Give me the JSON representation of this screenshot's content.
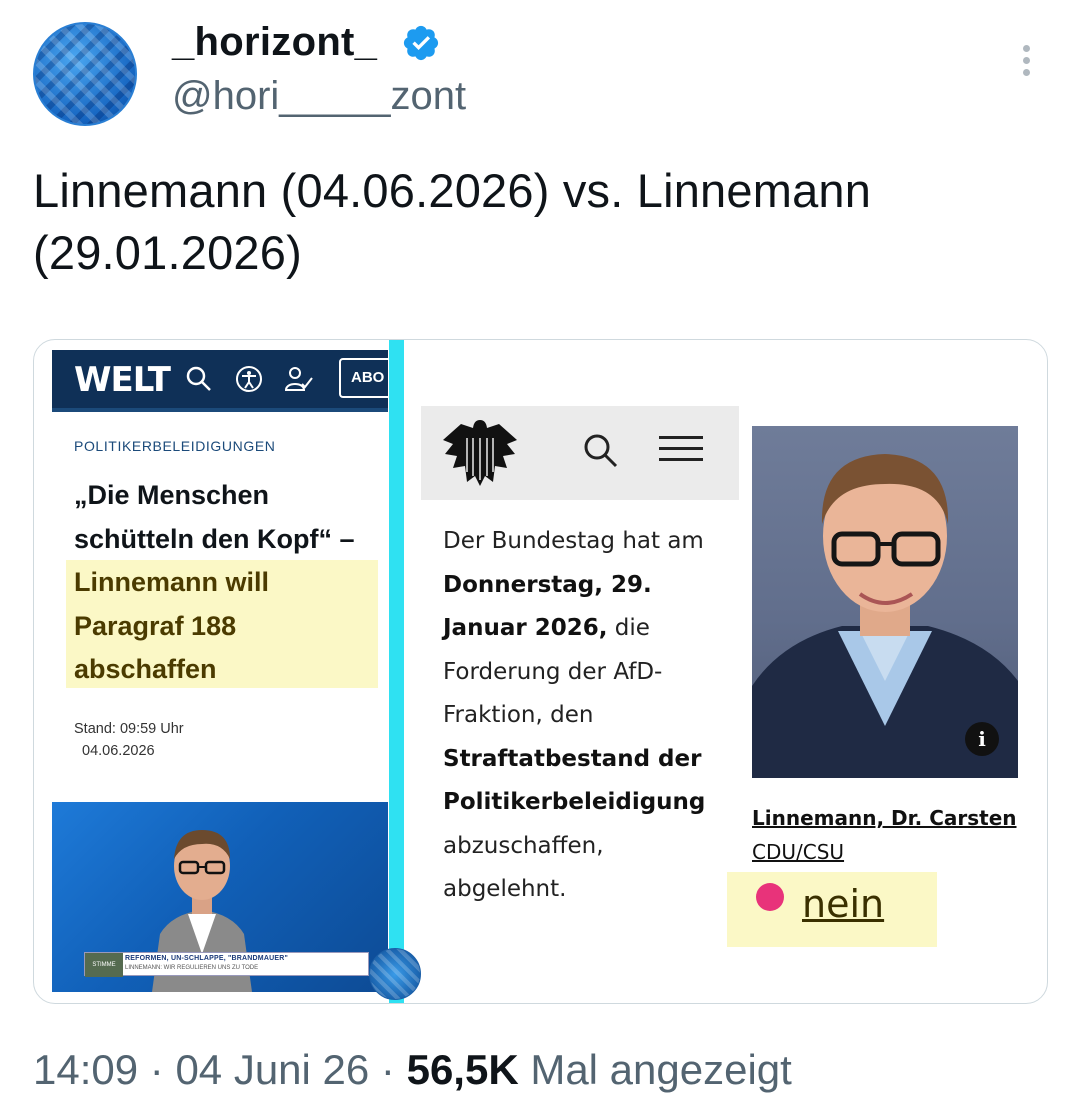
{
  "author": {
    "display_name": "_horizont_",
    "handle": "@hori_____zont",
    "verified": true,
    "avatar_icon": "blue-geometric-pattern-avatar"
  },
  "tweet": {
    "text": "Linnemann (04.06.2026) vs. Linnemann (29.01.2026)"
  },
  "media": {
    "welt": {
      "logo": "WELT",
      "abo_label": "ABO",
      "kicker": "POLITIKERBELEIDIGUNGEN",
      "headline_plain": "„Die Menschen schütteln den Kopf“ – ",
      "headline_highlight": "Linnemann will Paragraf 188 abschaffen",
      "stand_label": "Stand: 09:59 Uhr",
      "stand_date": "04.06.2026",
      "video_tag": "STIMME",
      "video_line1": "REFORMEN, UN-SCHLAPPE, \"BRANDMAUER\"",
      "video_line2": "LINNEMANN: WIR REGULIEREN UNS ZU TODE"
    },
    "bundestag": {
      "t1": "Der Bundestag hat am ",
      "t2": "Donnerstag, 29. Januar 2026,",
      "t3": " die Forderung der AfD-Fraktion, den ",
      "t4": "Straftatbestand der Politikerbeleidigung",
      "t5": " abzuschaffen, abgelehnt.",
      "mp_name": "Linnemann, Dr. Carsten",
      "mp_party": "CDU/CSU",
      "vote": "nein",
      "info_label": "i",
      "vote_color": "#e8337a"
    }
  },
  "meta": {
    "time": "14:09",
    "sep1": " · ",
    "date": "04 Juni 26",
    "sep2": " · ",
    "views": "56,5K",
    "views_label": " Mal angezeigt"
  },
  "colors": {
    "highlight": "#fbf8c6",
    "divider": "#2fe1f2",
    "welt_blue": "#0f3057",
    "verified_blue": "#1d9bf0"
  }
}
